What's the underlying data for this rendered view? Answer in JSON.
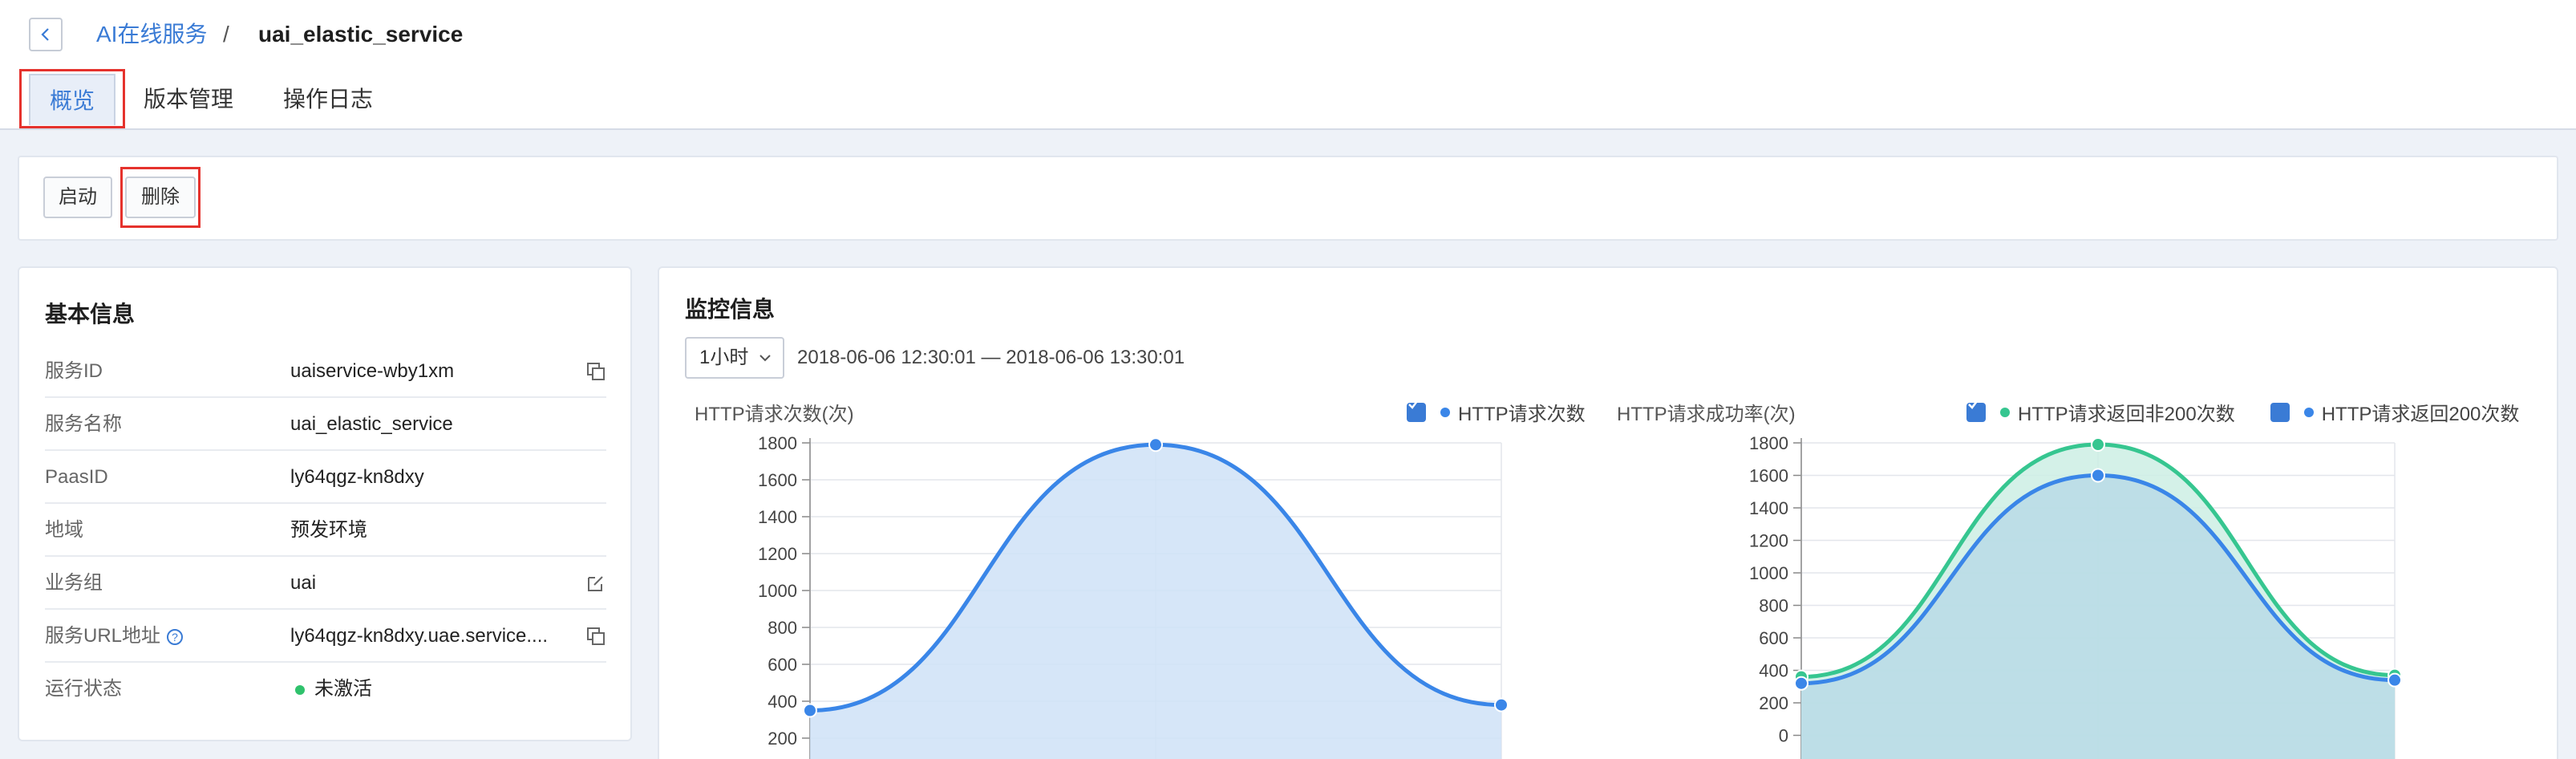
{
  "breadcrumb": {
    "parent": "AI在线服务",
    "separator": "/",
    "current": "uai_elastic_service"
  },
  "tabs": [
    {
      "label": "概览",
      "active": true
    },
    {
      "label": "版本管理",
      "active": false
    },
    {
      "label": "操作日志",
      "active": false
    }
  ],
  "actions": {
    "start_label": "启动",
    "delete_label": "删除"
  },
  "basic_info": {
    "title": "基本信息",
    "rows": [
      {
        "label": "服务ID",
        "value": "uaiservice-wby1xm",
        "action_icon": "copy-icon"
      },
      {
        "label": "服务名称",
        "value": "uai_elastic_service"
      },
      {
        "label": "PaasID",
        "value": "ly64qgz-kn8dxy"
      },
      {
        "label": "地域",
        "value": "预发环境"
      },
      {
        "label": "业务组",
        "value": "uai",
        "action_icon": "edit-icon"
      },
      {
        "label": "服务URL地址",
        "value": "ly64qgz-kn8dxy.uae.service....",
        "action_icon": "copy-icon",
        "help": "?"
      },
      {
        "label": "运行状态",
        "value": "未激活",
        "status_color": "#2fc26c"
      }
    ]
  },
  "monitor": {
    "title": "监控信息",
    "time_select": "1小时",
    "time_range": "2018-06-06 12:30:01 — 2018-06-06 13:30:01"
  },
  "chart_data": [
    {
      "type": "area",
      "ylabel": "HTTP请求次数(次)",
      "yticks": [
        "1800",
        "1600",
        "1400",
        "1200",
        "1000",
        "800",
        "600",
        "400",
        "200"
      ],
      "ylim": [
        0,
        1800
      ],
      "grid": true,
      "legend_position": "top-right",
      "series": [
        {
          "name": "HTTP请求次数",
          "color": "#3a86e8",
          "fill": "#cfe2f7",
          "values": [
            350,
            1790,
            380
          ]
        }
      ]
    },
    {
      "type": "area",
      "ylabel": "HTTP请求成功率(次)",
      "yticks": [
        "1800",
        "1600",
        "1400",
        "1200",
        "1000",
        "800",
        "600",
        "400",
        "200",
        "0"
      ],
      "ylim": [
        0,
        1800
      ],
      "grid": true,
      "legend_position": "top-right",
      "series": [
        {
          "name": "HTTP请求返回非200次数",
          "color": "#36c690",
          "fill": "#cdeee4",
          "values": [
            360,
            1790,
            370
          ]
        },
        {
          "name": "HTTP请求返回200次数",
          "color": "#3a86e8",
          "fill": "#b8dbe6",
          "values": [
            320,
            1600,
            340
          ]
        }
      ]
    }
  ],
  "colors": {
    "accent": "#3a7bd5",
    "highlight_border": "#e5322d"
  }
}
